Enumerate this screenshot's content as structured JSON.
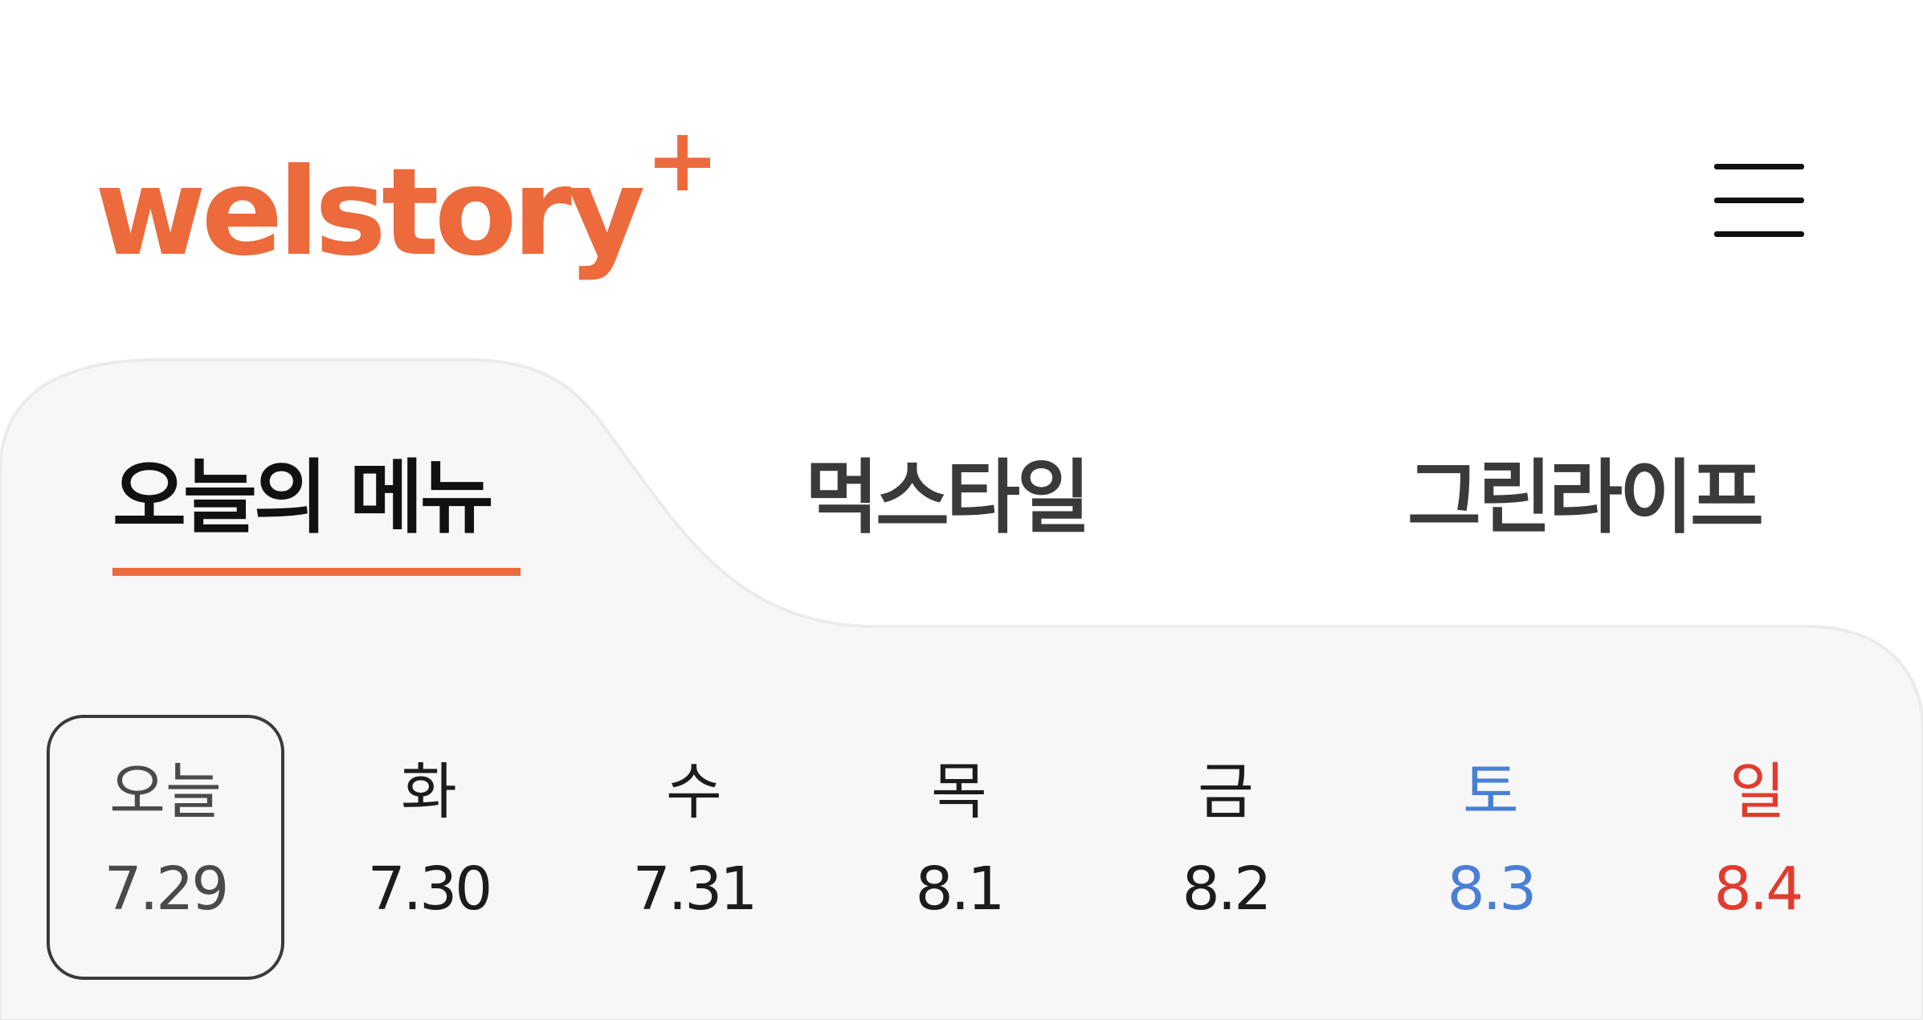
{
  "header": {
    "logo_text": "welstory",
    "logo_plus": "+",
    "menu_icon": "hamburger-menu-icon"
  },
  "tabs": [
    {
      "label": "오늘의 메뉴",
      "active": true
    },
    {
      "label": "먹스타일",
      "active": false
    },
    {
      "label": "그린라이프",
      "active": false
    }
  ],
  "days": [
    {
      "label": "오늘",
      "date": "7.29",
      "selected": true
    },
    {
      "label": "화",
      "date": "7.30"
    },
    {
      "label": "수",
      "date": "7.31"
    },
    {
      "label": "목",
      "date": "8.1"
    },
    {
      "label": "금",
      "date": "8.2"
    },
    {
      "label": "토",
      "date": "8.3"
    },
    {
      "label": "일",
      "date": "8.4"
    }
  ],
  "colors": {
    "brand": "#ec6a3c",
    "saturday": "#4a7fd6",
    "sunday": "#e23b2e",
    "panel": "#f7f7f7"
  }
}
